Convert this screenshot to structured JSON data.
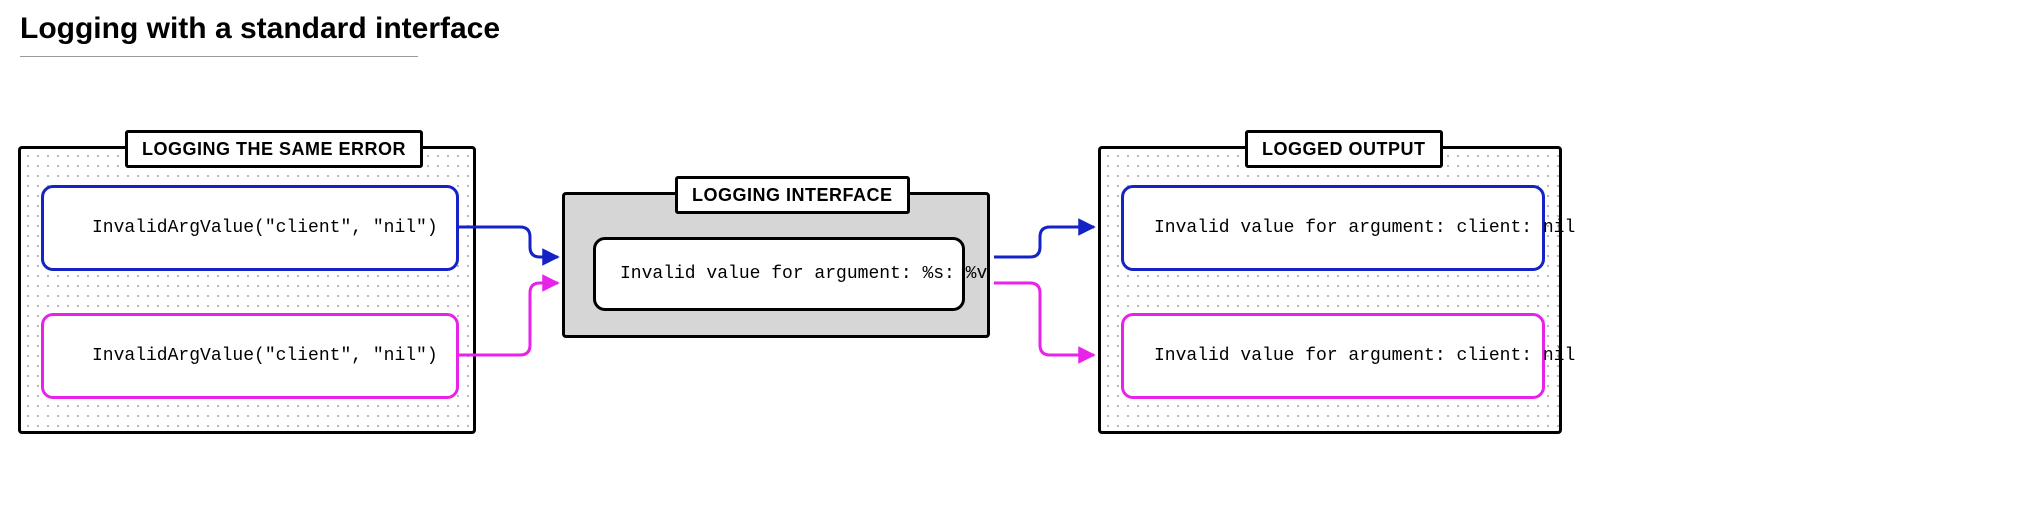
{
  "title": "Logging with a standard interface",
  "left_panel": {
    "label": "LOGGING THE SAME ERROR",
    "calls": [
      "InvalidArgValue(\"client\", \"nil\")",
      "InvalidArgValue(\"client\", \"nil\")"
    ]
  },
  "center_panel": {
    "label": "LOGGING INTERFACE",
    "format": "Invalid value for argument: %s: %v"
  },
  "right_panel": {
    "label": "LOGGED OUTPUT",
    "outputs": [
      "Invalid value for argument: client: nil",
      "Invalid value for argument: client: nil"
    ]
  },
  "colors": {
    "blue": "#1522c6",
    "pink": "#e822e8"
  }
}
